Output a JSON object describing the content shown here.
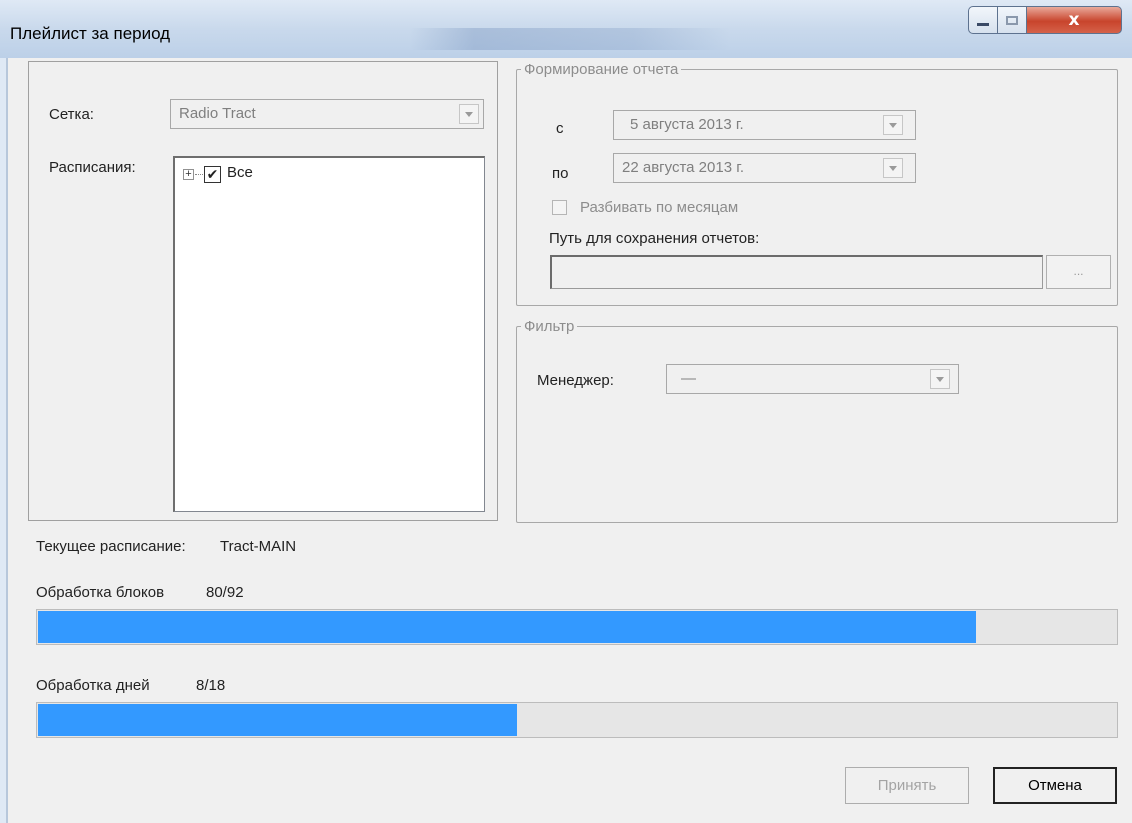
{
  "window": {
    "title": "Плейлист за период",
    "close_glyph": "x"
  },
  "left_panel": {
    "grid_label": "Сетка:",
    "grid_value": "Radio Tract",
    "schedules_label": "Расписания:",
    "tree": {
      "expander": "+",
      "check_mark": "✔",
      "item_label": "Все",
      "checked": true
    }
  },
  "report_group": {
    "legend": "Формирование отчета",
    "from_label": "с",
    "from_value": "5 августа  2013 г.",
    "to_label": "по",
    "to_value": "22 августа  2013 г.",
    "split_by_month_label": "Разбивать по месяцам",
    "split_by_month_checked": false,
    "save_path_label": "Путь для сохранения отчетов:",
    "save_path_value": "",
    "browse_label": "..."
  },
  "filter_group": {
    "legend": "Фильтр",
    "manager_label": "Менеджер:",
    "manager_value": "—"
  },
  "status": {
    "current_schedule_label": "Текущее расписание:",
    "current_schedule_value": "Tract-MAIN",
    "blocks_label": "Обработка блоков",
    "blocks_count": "80/92",
    "blocks_fraction": 0.87,
    "days_label": "Обработка дней",
    "days_count": "8/18",
    "days_fraction": 0.444
  },
  "buttons": {
    "accept_label": "Принять",
    "cancel_label": "Отмена"
  },
  "colors": {
    "progress_fill": "#3399ff",
    "title_bar": "#c9d9ec"
  }
}
